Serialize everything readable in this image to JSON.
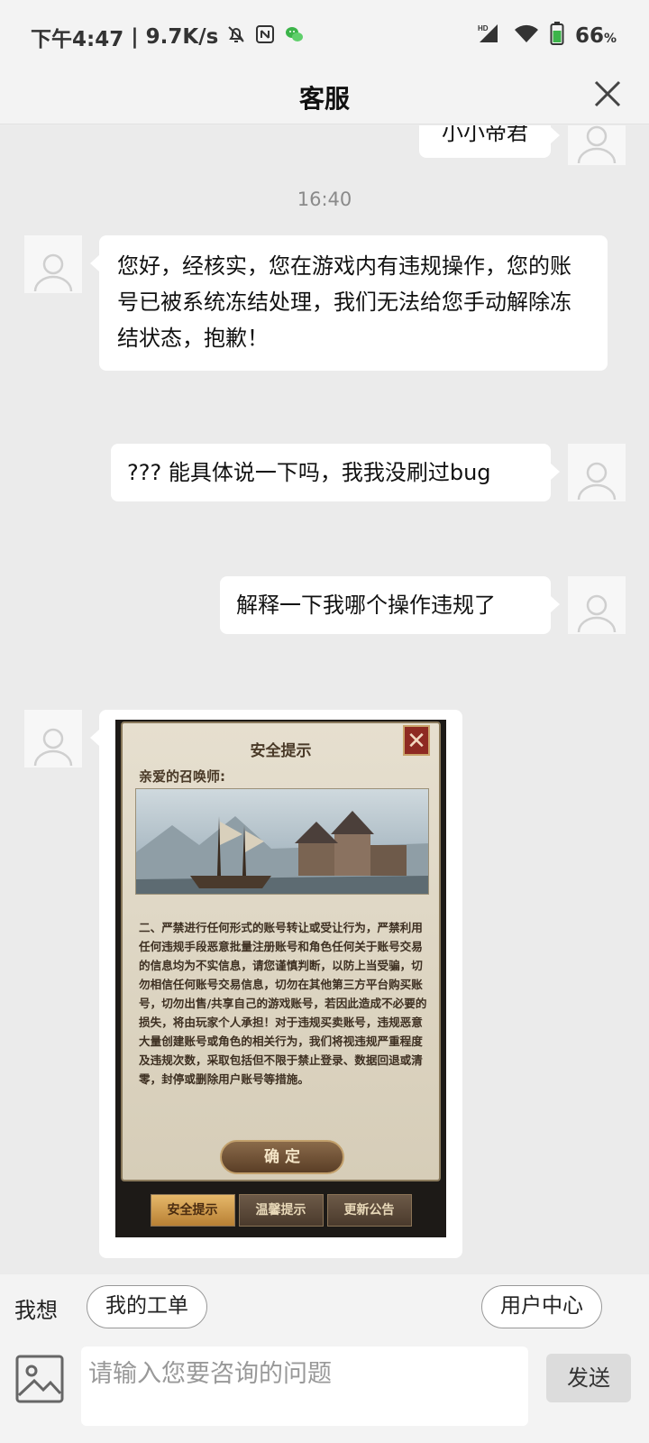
{
  "status_bar": {
    "time": "下午4:47",
    "network_speed": "9.7K/s",
    "battery": "66",
    "battery_unit": "%",
    "hd_label": "HD"
  },
  "header": {
    "title": "客服"
  },
  "chat": {
    "partial_message": "小小帝君",
    "timestamp": "16:40",
    "messages": [
      {
        "side": "left",
        "text": "您好，经核实，您在游戏内有违规操作，您的账号已被系统冻结处理，我们无法给您手动解除冻结状态，抱歉！"
      },
      {
        "side": "right",
        "text": "??? 能具体说一下吗，我我没刷过bug"
      },
      {
        "side": "right",
        "text": "解释一下我哪个操作违规了"
      }
    ],
    "game_image": {
      "title": "安全提示",
      "greeting": "亲爱的召唤师:",
      "close_glyph": "✕",
      "body": "二、严禁进行任何形式的账号转让或受让行为，严禁利用任何违规手段恶意批量注册账号和角色任何关于账号交易的信息均为不实信息，请您谨慎判断，以防上当受骗，切勿相信任何账号交易信息，切勿在其他第三方平台购买账号，切勿出售/共享自己的游戏账号，若因此造成不必要的损失，将由玩家个人承担！对于违规买卖账号，违规恶意大量创建账号或角色的相关行为，我们将视违规严重程度及违规次数，采取包括但不限于禁止登录、数据回退或清零，封停或删除用户账号等措施。",
      "confirm": "确 定",
      "tabs": [
        "安全提示",
        "温馨提示",
        "更新公告"
      ]
    }
  },
  "quick_bar": {
    "label": "我想",
    "my_tickets": "我的工单",
    "user_center": "用户中心"
  },
  "input_bar": {
    "placeholder": "请输入您要咨询的问题",
    "send": "发送"
  },
  "colors": {
    "bubble": "#ffffff",
    "background": "#ebebeb",
    "bar": "#f3f3f3",
    "battery_green": "#3cb44a"
  }
}
